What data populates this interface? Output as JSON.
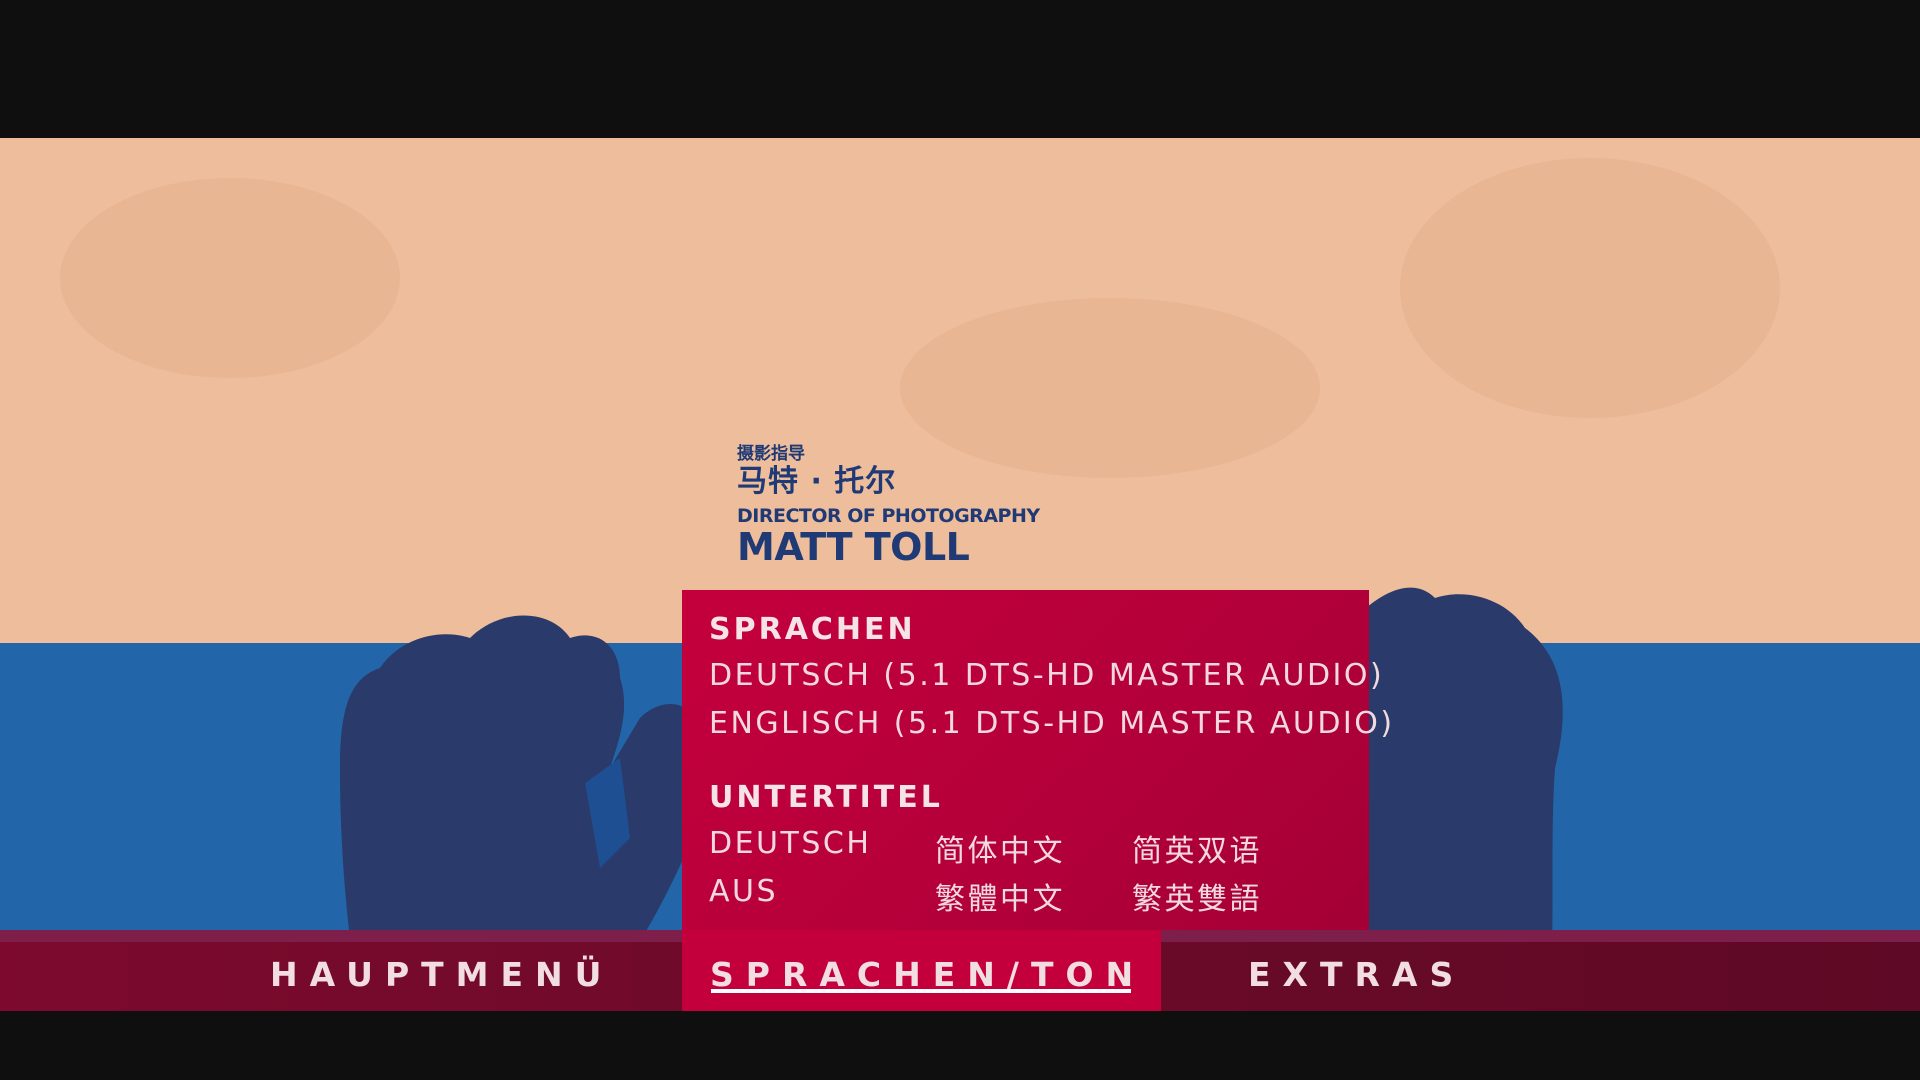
{
  "credits": {
    "role_cn": "摄影指导",
    "name_cn": "马特 · 托尔",
    "role_en": "DIRECTOR OF PHOTOGRAPHY",
    "name_en": "MATT TOLL"
  },
  "menu_panel": {
    "audio_heading": "SPRACHEN",
    "audio_options": [
      "DEUTSCH (5.1 DTS-HD MASTER AUDIO)",
      "ENGLISCH (5.1 DTS-HD MASTER AUDIO)"
    ],
    "subtitle_heading": "UNTERTITEL",
    "subtitle_options": [
      [
        "DEUTSCH",
        "简体中文",
        "简英双语"
      ],
      [
        "AUS",
        "繁體中文",
        "繁英雙語"
      ]
    ]
  },
  "nav": {
    "items": [
      "HAUPTMENÜ",
      "SPRACHEN/TON",
      "EXTRAS"
    ],
    "active": "SPRACHEN/TON"
  },
  "colors": {
    "letterbox": "#0f0f0f",
    "sky": "#eebd9c",
    "water": "#2266a9",
    "hands": "#2a3a6a",
    "panel": "#c4003c",
    "navbar": "#6e0a2a"
  }
}
